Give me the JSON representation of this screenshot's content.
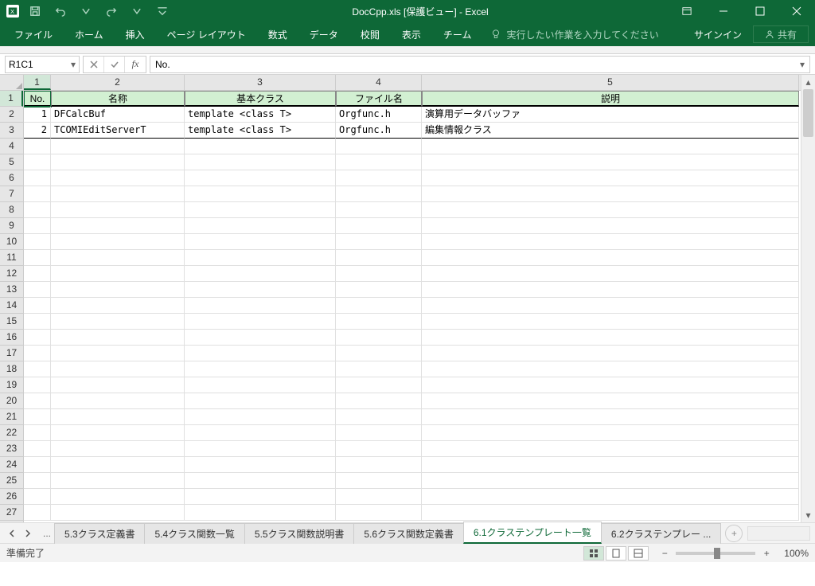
{
  "title": "DocCpp.xls [保護ビュー] - Excel",
  "ribbon": {
    "tabs": [
      "ファイル",
      "ホーム",
      "挿入",
      "ページ レイアウト",
      "数式",
      "データ",
      "校閲",
      "表示",
      "チーム"
    ],
    "tellme": "実行したい作業を入力してください",
    "signin": "サインイン",
    "share": "共有"
  },
  "formula": {
    "name_box": "R1C1",
    "input": "No."
  },
  "columns": {
    "col1_w": 34,
    "col2_w": 168,
    "col3_w": 190,
    "col4_w": 108,
    "col5_w": 474
  },
  "col_labels": [
    "1",
    "2",
    "3",
    "4",
    "5"
  ],
  "headers": {
    "c1": "No.",
    "c2": "名称",
    "c3": "基本クラス",
    "c4": "ファイル名",
    "c5": "説明"
  },
  "rows": [
    {
      "no": "1",
      "name": "DFCalcBuf",
      "base": "template <class T>",
      "file": "Orgfunc.h",
      "desc": "演算用データバッファ"
    },
    {
      "no": "2",
      "name": "TCOMIEditServerT",
      "base": "template <class T>",
      "file": "Orgfunc.h",
      "desc": "編集情報クラス"
    }
  ],
  "row_labels": [
    "1",
    "2",
    "3",
    "4",
    "5",
    "6",
    "7",
    "8",
    "9",
    "10",
    "11",
    "12",
    "13",
    "14",
    "15",
    "16",
    "17",
    "18",
    "19",
    "20",
    "21",
    "22",
    "23",
    "24",
    "25",
    "26",
    "27"
  ],
  "sheet_tabs": [
    "5.3クラス定義書",
    "5.4クラス関数一覧",
    "5.5クラス関数説明書",
    "5.6クラス関数定義書",
    "6.1クラステンプレート一覧",
    "6.2クラステンプレー ..."
  ],
  "active_tab_index": 4,
  "status": "準備完了",
  "zoom": "100%"
}
